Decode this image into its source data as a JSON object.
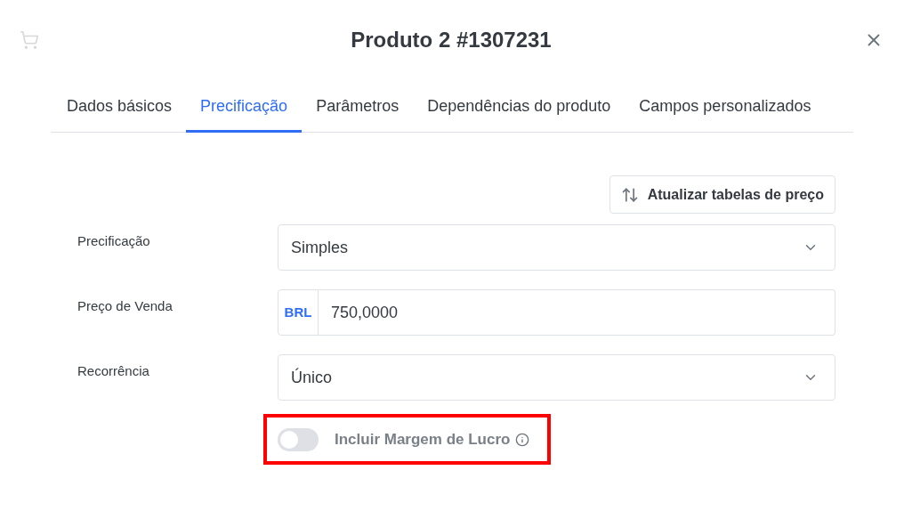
{
  "header": {
    "title": "Produto 2 #1307231"
  },
  "tabs": [
    {
      "label": "Dados básicos",
      "selected": false
    },
    {
      "label": "Precificação",
      "selected": true
    },
    {
      "label": "Parâmetros",
      "selected": false
    },
    {
      "label": "Dependências do produto",
      "selected": false
    },
    {
      "label": "Campos personalizados",
      "selected": false
    }
  ],
  "action_button": {
    "label": "Atualizar tabelas de preço"
  },
  "fields": [
    {
      "kind": "select",
      "label": "Precificação",
      "value": "Simples"
    },
    {
      "kind": "currency",
      "label": "Preço de Venda",
      "currency": "BRL",
      "value": "750,0000"
    },
    {
      "kind": "select",
      "label": "Recorrência",
      "value": "Único"
    }
  ],
  "toggle": {
    "label": "Incluir Margem de Lucro",
    "on": false,
    "highlighted": true
  }
}
